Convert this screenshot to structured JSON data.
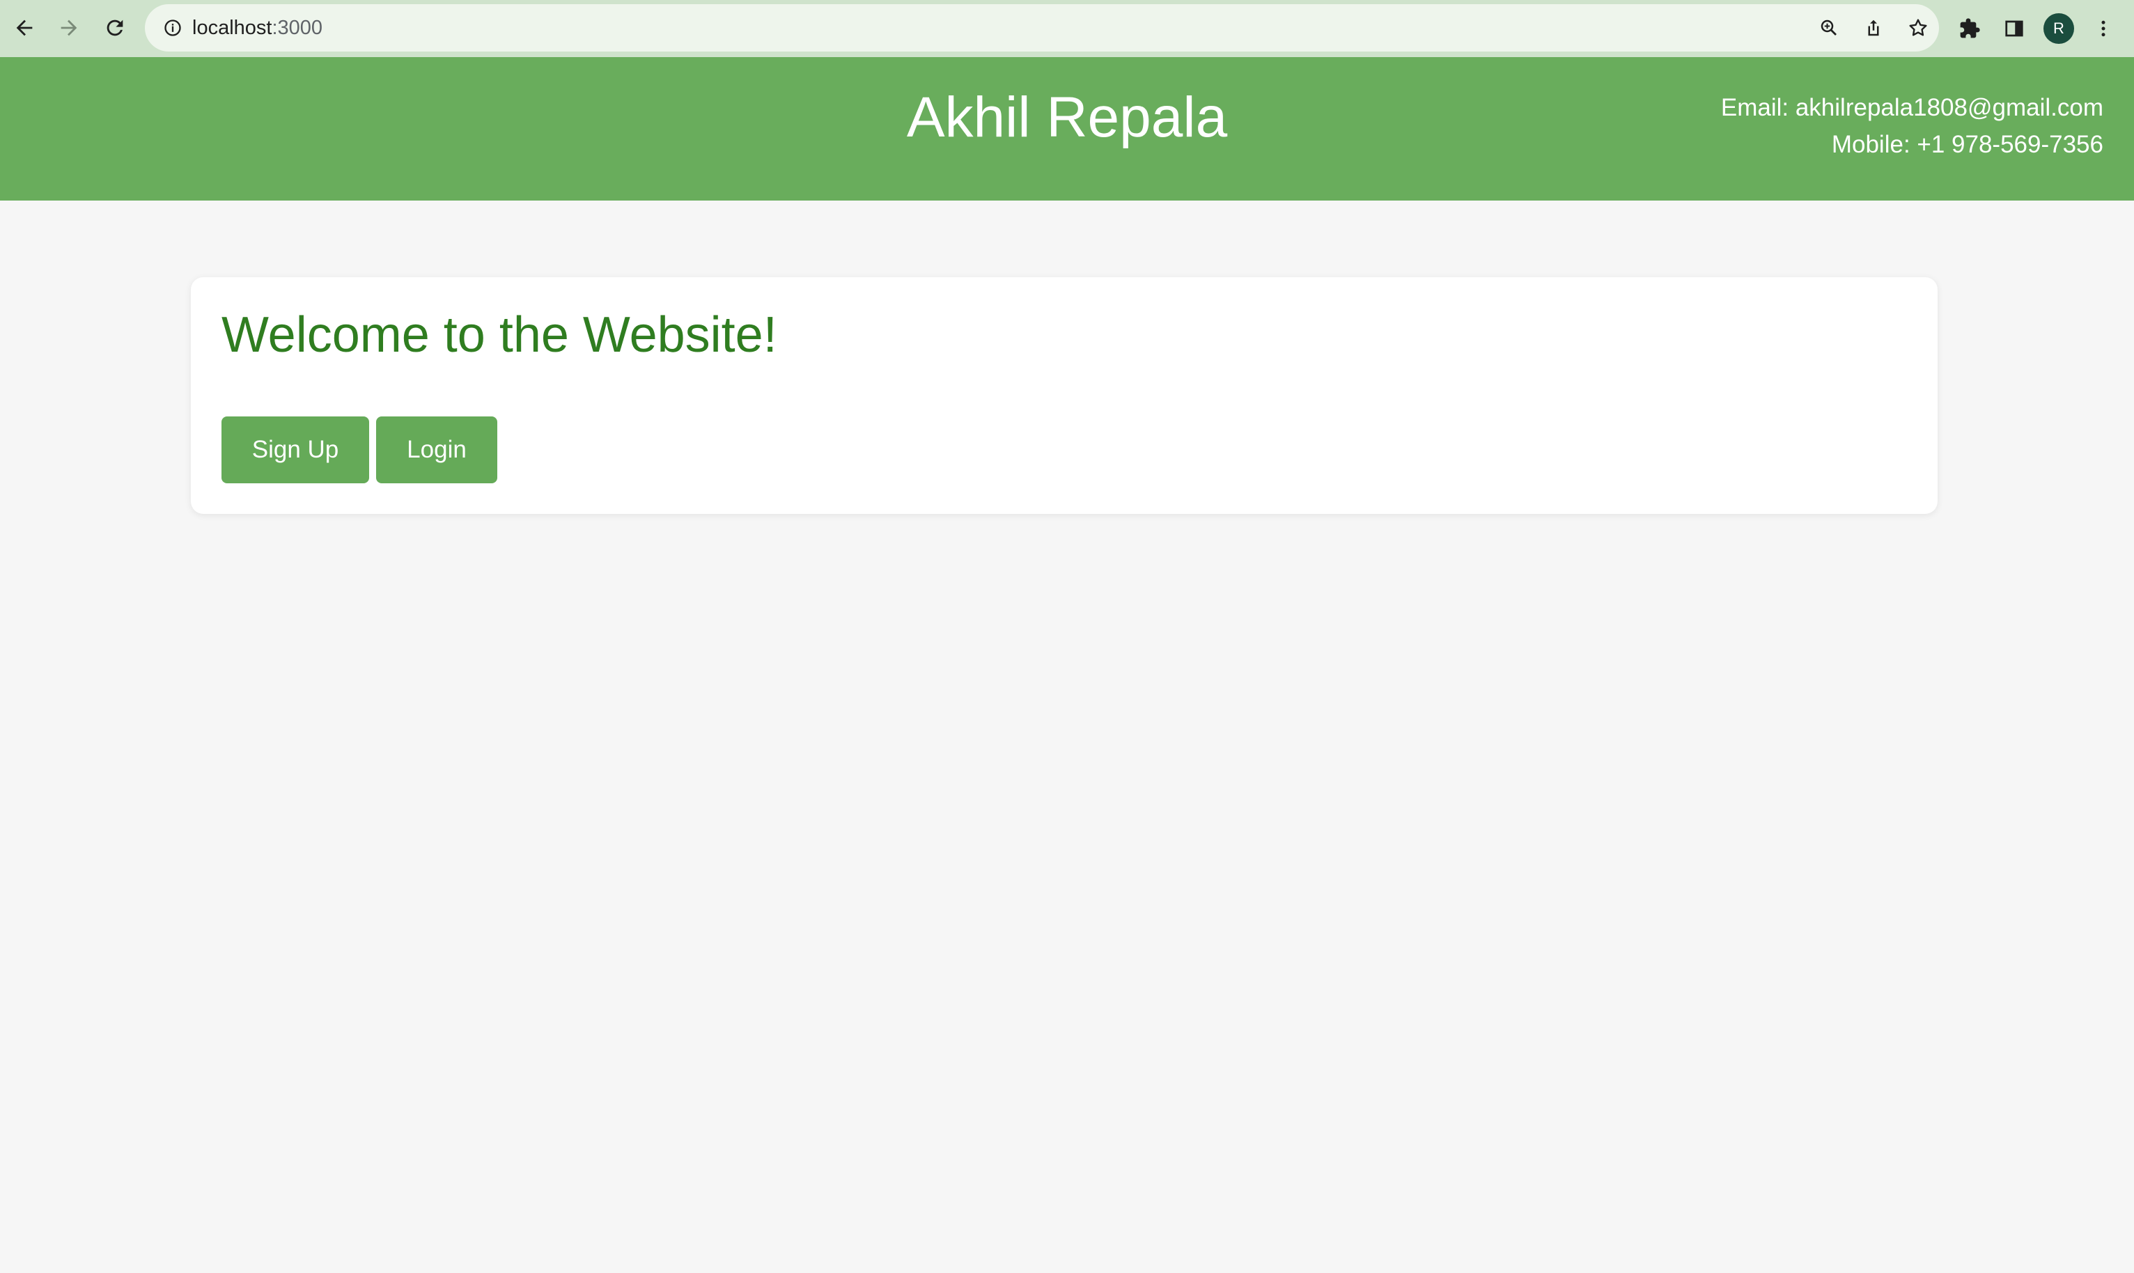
{
  "browser": {
    "url_host": "localhost",
    "url_port": ":3000",
    "avatar_letter": "R",
    "icons": [
      "back-arrow-icon",
      "forward-arrow-icon",
      "reload-icon",
      "site-info-icon",
      "zoom-icon",
      "share-icon",
      "bookmark-star-icon",
      "extensions-puzzle-icon",
      "side-panel-icon",
      "more-vert-icon"
    ]
  },
  "header": {
    "title": "Akhil Repala",
    "email": "Email: akhilrepala1808@gmail.com",
    "mobile": "Mobile: +1 978-569-7356"
  },
  "main": {
    "welcome": "Welcome to the Website!",
    "signup_label": "Sign Up",
    "login_label": "Login"
  },
  "colors": {
    "header_bg": "#69ad5c",
    "button_bg": "#65aa58",
    "heading": "#2f7d20",
    "page_bg": "#f6f6f6",
    "browser_bar": "#cfe3cc"
  }
}
